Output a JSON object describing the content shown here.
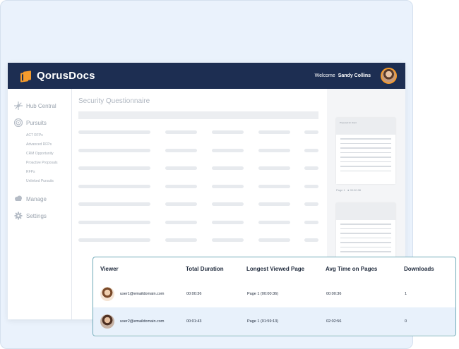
{
  "app": {
    "brand": "QorusDocs",
    "welcome_label": "Welcome",
    "user_name": "Sandy Collins",
    "colors": {
      "topbar": "#1d2e52",
      "accent": "#f59b2c",
      "popup_border": "#6fa9b8",
      "row_highlight": "#e8f1fb"
    }
  },
  "sidebar": {
    "hub": {
      "label": "Hub Central",
      "icon": "hub-icon"
    },
    "pursuits": {
      "label": "Pursuits",
      "icon": "target-icon",
      "items": [
        "ACT RFPs",
        "Advanced RFPs",
        "CRM Opportunity",
        "Proactive Proposals",
        "RFPs",
        "Unlinked Pursuits"
      ]
    },
    "manage": {
      "label": "Manage",
      "icon": "cloud-icon"
    },
    "settings": {
      "label": "Settings",
      "icon": "gear-icon"
    }
  },
  "content": {
    "title": "Security Questionnaire"
  },
  "preview": {
    "thumb_title": "Proposal for client",
    "page_label": "Page 1",
    "time_label": "00:00:36"
  },
  "viewers": {
    "headers": [
      "Viewer",
      "Total Duration",
      "Longest Viewed Page",
      "Avg Time on Pages",
      "Downloads"
    ],
    "rows": [
      {
        "email": "user1@emaildomain.com",
        "total": "00:00:36",
        "longest": "Page 1 (00:00:36)",
        "avg": "00:00:36",
        "downloads": "1"
      },
      {
        "email": "user2@emaildomain.com",
        "total": "00:01:43",
        "longest": "Page 1 (01:59:13)",
        "avg": "02:02:56",
        "downloads": "0"
      }
    ]
  }
}
